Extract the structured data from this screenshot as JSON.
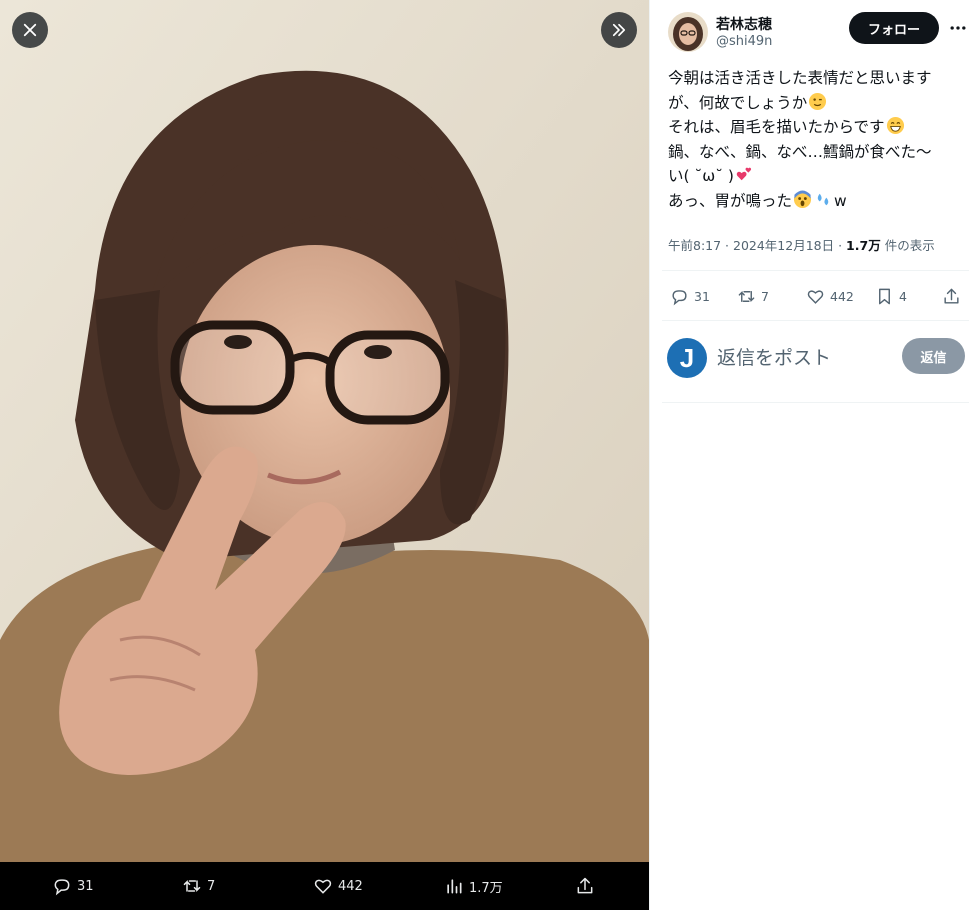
{
  "media_bar": {
    "replies": "31",
    "reposts": "7",
    "likes": "442",
    "views": "1.7万"
  },
  "author": {
    "name": "若林志穂",
    "handle": "@shi49n",
    "follow_label": "フォロー"
  },
  "tweet": {
    "lines": [
      "今朝は活き活きした表情だと思います",
      "が、何故でしょうか",
      "それは、眉毛を描いたからです",
      "鍋、なべ、鍋、なべ…鱈鍋が食べた〜",
      "い( ˘ω˘ )",
      "あっ、胃が鳴った",
      "w"
    ],
    "time": "午前8:17",
    "date": "2024年12月18日",
    "views_count": "1.7万",
    "views_label": "件の表示"
  },
  "actions": {
    "replies": "31",
    "reposts": "7",
    "likes": "442",
    "bookmarks": "4"
  },
  "reply_box": {
    "avatar_letter": "J",
    "placeholder": "返信をポスト",
    "button_label": "返信"
  },
  "colors": {
    "accent_dark": "#0f1419",
    "muted": "#536471",
    "reply_button": "#8b98a5",
    "reply_avatar": "#1d6fb4"
  },
  "icons": [
    "close-icon",
    "next-icon",
    "reply-icon",
    "repost-icon",
    "like-icon",
    "views-icon",
    "share-icon",
    "bookmark-icon",
    "more-icon"
  ]
}
